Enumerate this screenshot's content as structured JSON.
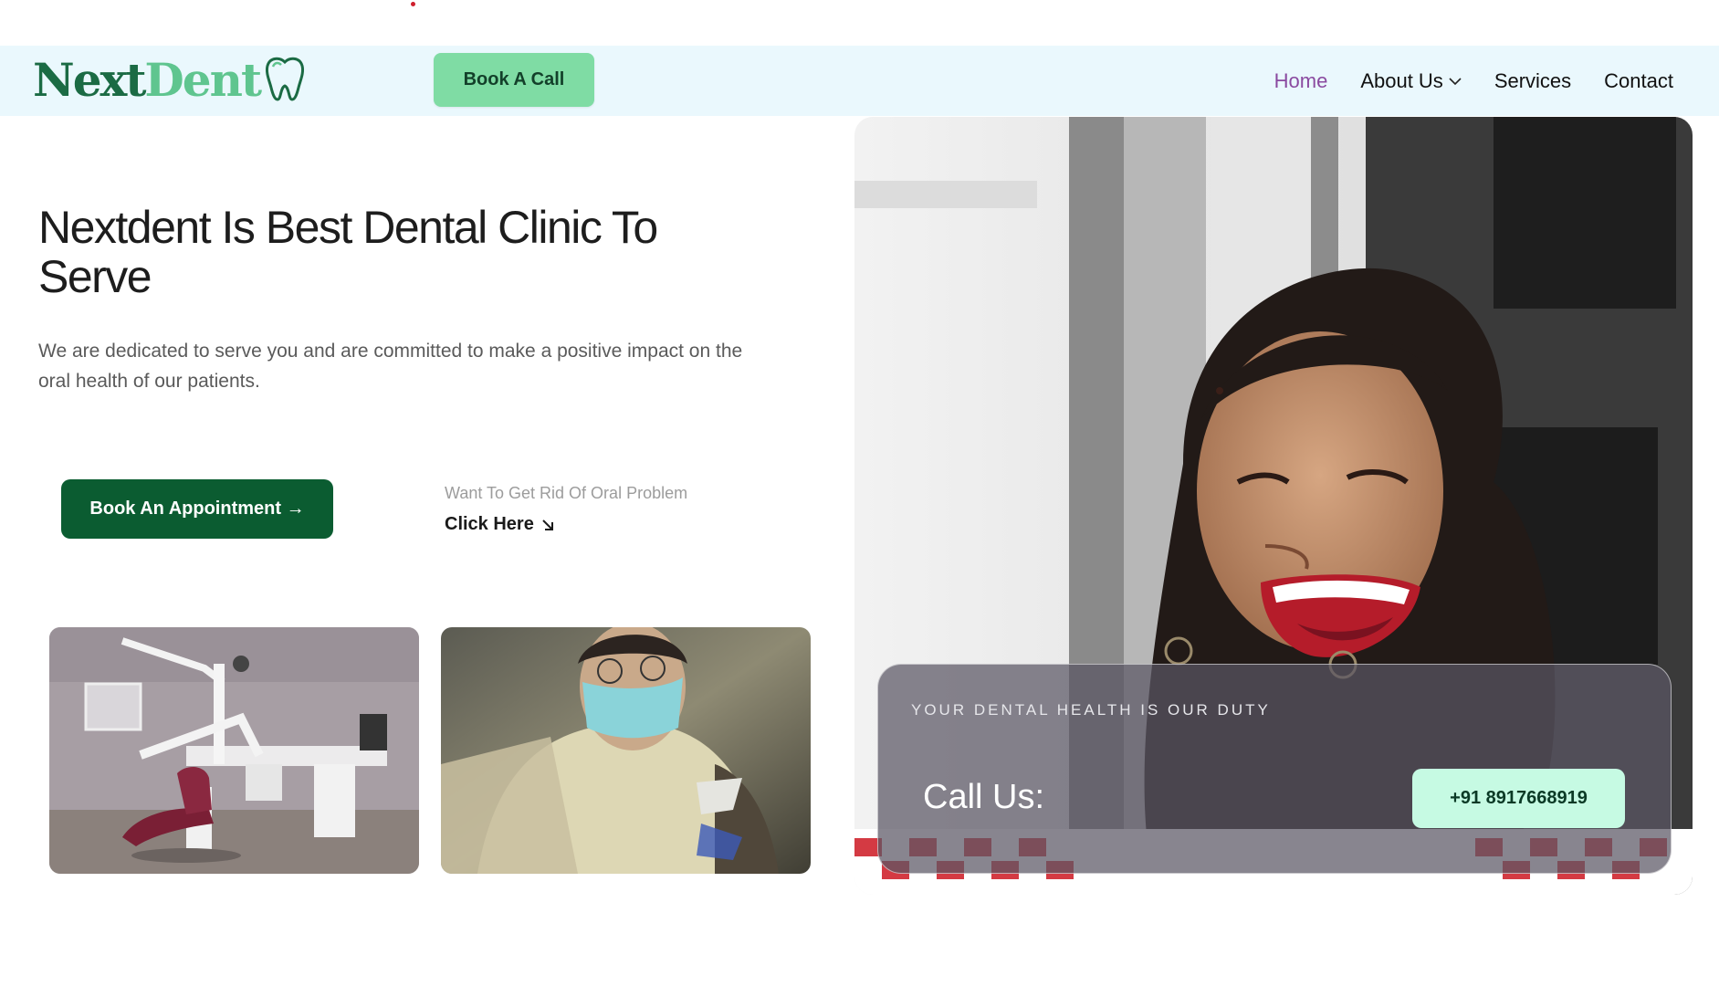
{
  "header": {
    "logo": {
      "part1": "Next",
      "part2": "Dent"
    },
    "book_call_label": "Book A Call",
    "nav": [
      {
        "label": "Home"
      },
      {
        "label": "About Us"
      },
      {
        "label": "Services"
      },
      {
        "label": "Contact"
      }
    ]
  },
  "hero": {
    "title": "Nextdent Is Best Dental Clinic To Serve",
    "description": "We are dedicated to serve you and are committed to make a positive impact on the oral health of our patients.",
    "appointment_label": "Book An Appointment →",
    "rid_label": "Want To Get Rid Of Oral Problem",
    "click_here_label": "Click Here"
  },
  "call_card": {
    "tagline": "YOUR DENTAL HEALTH IS OUR DUTY",
    "call_label": "Call Us:",
    "phone": "+91 8917668919"
  },
  "colors": {
    "header_bg": "#eaf8fd",
    "brand_dark_green": "#0b5c31",
    "brand_light_green": "#7fdca4",
    "nav_active": "#8a4aa0",
    "phone_button": "#c6fae3"
  },
  "icons": {
    "logo_mark": "tooth-icon",
    "about_dropdown": "chevron-down-icon",
    "click_here": "arrow-down-right-icon"
  }
}
